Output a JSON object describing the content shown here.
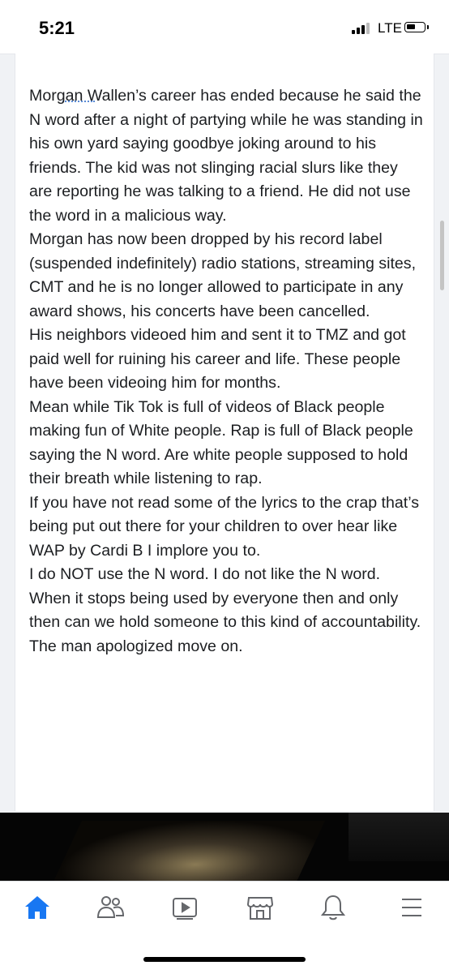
{
  "status_bar": {
    "time": "5:21",
    "network": "LTE"
  },
  "post": {
    "paragraphs": [
      "Morgan Wallen’s career has ended because he said the N word after a night of partying while he was standing in his own yard saying goodbye joking around to his friends. The kid was not slinging racial slurs like they are reporting he was talking to a friend. He did not use the word in a malicious way.",
      "Morgan has now been dropped by his record label (suspended indefinitely) radio stations, streaming sites, CMT and he is no longer allowed to participate in any award shows, his concerts have been cancelled.",
      "His neighbors videoed him and sent it to TMZ and got paid well for ruining his career and life. These people have been videoing him for months.",
      "Mean while Tik Tok is full of videos of Black people making fun of White people. Rap is full of Black people saying the N word. Are white people supposed to hold their breath while listening to rap.",
      "If you have not read some of the lyrics to the crap that’s being put out there for your children to over hear like WAP by Cardi B I implore you to.",
      "I do NOT use the N word. I do not like the N word. When it stops being used by everyone then and only then can we hold someone to this kind of accountability. The man apologized move on."
    ]
  },
  "tab_bar": {
    "tabs": [
      {
        "icon": "home-icon",
        "active": true
      },
      {
        "icon": "friends-icon",
        "active": false
      },
      {
        "icon": "watch-icon",
        "active": false
      },
      {
        "icon": "marketplace-icon",
        "active": false
      },
      {
        "icon": "notifications-icon",
        "active": false
      },
      {
        "icon": "menu-icon",
        "active": false
      }
    ]
  },
  "colors": {
    "accent": "#1877f2",
    "icon_inactive": "#65676b",
    "text": "#1c1e21"
  }
}
